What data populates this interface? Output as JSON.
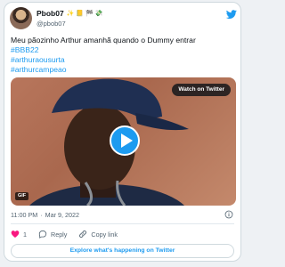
{
  "author": {
    "display_name": "Pbob07",
    "emojis": "✨ 📒 🏁 💸",
    "handle": "@pbob07"
  },
  "tweet": {
    "lines": [
      "Meu pãozinho  Arthur amanhã quando o Dummy entrar",
      "#BBB22",
      "#arthuraousurta",
      "#arthurcampeao"
    ],
    "time": "11:00 PM",
    "separator": "·",
    "date": "Mar 9, 2022"
  },
  "media": {
    "watch_label": "Watch on Twitter",
    "gif_label": "GIF"
  },
  "actions": {
    "like_count": "1",
    "reply_label": "Reply",
    "copy_link_label": "Copy link"
  },
  "explore_label": "Explore what's happening on Twitter",
  "colors": {
    "accent": "#1d9bf0",
    "like": "#f91880",
    "secondary_text": "#536471"
  }
}
